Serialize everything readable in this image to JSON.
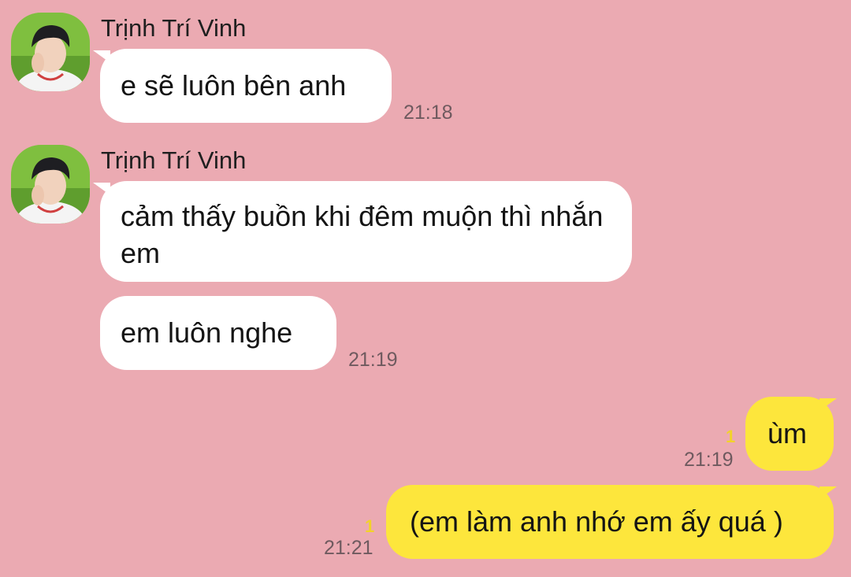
{
  "messages": [
    {
      "sender": "Trịnh Trí Vinh",
      "text": "e sẽ luôn bên anh",
      "time": "21:18"
    },
    {
      "sender": "Trịnh Trí Vinh",
      "text": "cảm thấy buồn khi đêm muộn thì nhắn em"
    },
    {
      "text": "em luôn nghe",
      "time": "21:19"
    },
    {
      "text": "ùm",
      "time": "21:19",
      "unread": "1"
    },
    {
      "text": "(em làm anh nhớ em ấy quá )",
      "time": "21:21",
      "unread": "1"
    }
  ],
  "colors": {
    "background": "#ebaab2",
    "incoming_bubble": "#ffffff",
    "outgoing_bubble": "#fde63c",
    "unread_count": "#f2d22a"
  },
  "icons": {
    "avatar": "profile-photo"
  }
}
